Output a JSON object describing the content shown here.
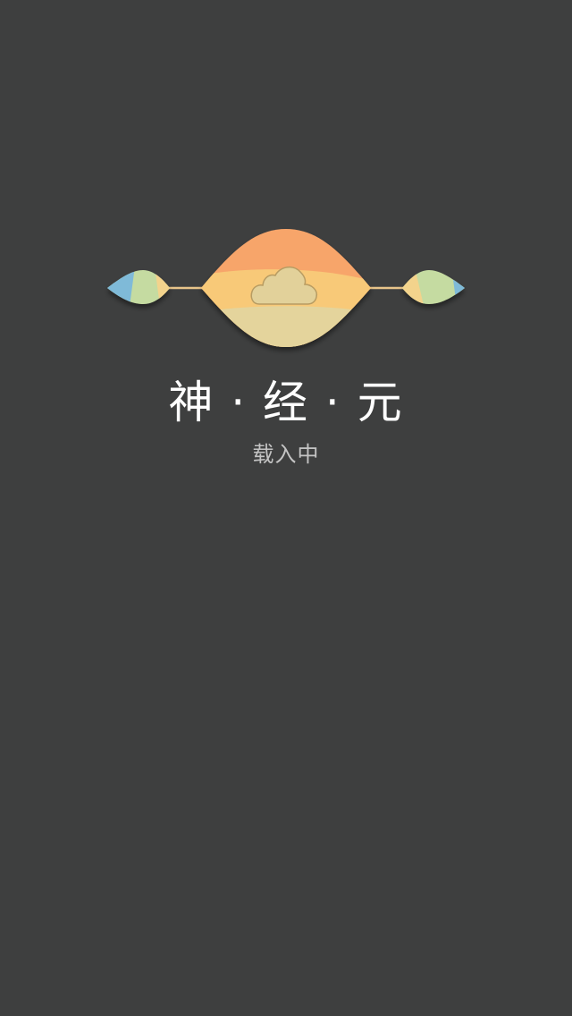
{
  "app": {
    "title": "神 · 经 · 元",
    "loading_text": "载入中"
  },
  "theme": {
    "background": "#3e3f3f",
    "title_color": "#ffffff",
    "subtitle_color": "#c4c4c4",
    "accent_orange": "#f7a56b",
    "accent_yellow": "#f8c978",
    "accent_sand": "#e4d49c",
    "accent_green": "#c5dba1",
    "accent_blue": "#7fbad8"
  },
  "logo": {
    "icon": "cloud-icon",
    "description_icons": [
      "left-leaf-icon",
      "center-lens-icon",
      "right-leaf-icon"
    ]
  }
}
